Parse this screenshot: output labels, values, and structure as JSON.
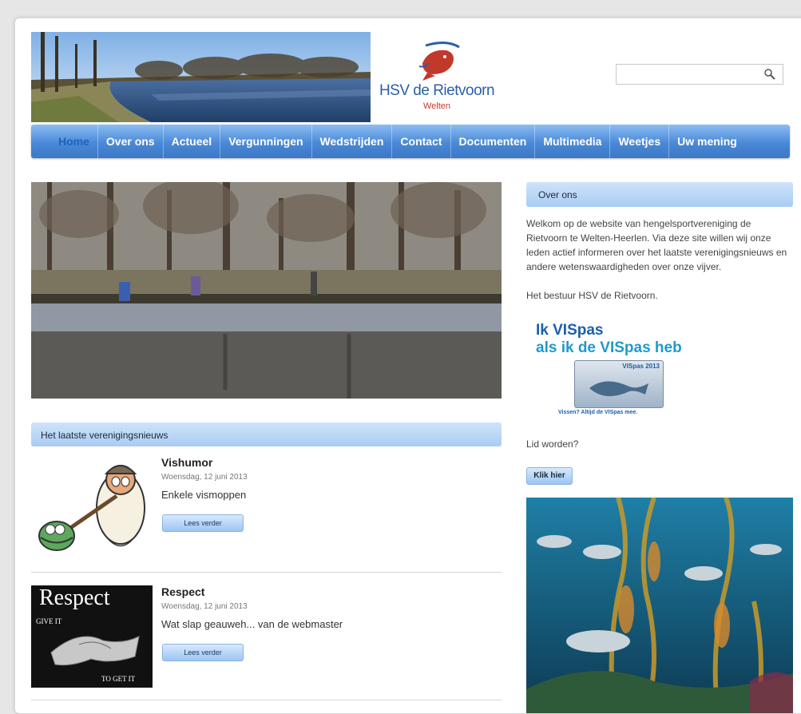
{
  "site": {
    "logo_name": "HSV de Rietvoorn",
    "logo_sub": "Welten"
  },
  "search": {
    "placeholder": "",
    "value": ""
  },
  "nav": {
    "items": [
      "Home",
      "Over ons",
      "Actueel",
      "Vergunningen",
      "Wedstrijden",
      "Contact",
      "Documenten",
      "Multimedia",
      "Weetjes",
      "Uw mening"
    ],
    "active": "Home"
  },
  "news": {
    "section_title": "Het laatste verenigingsnieuws",
    "items": [
      {
        "title": "Vishumor",
        "date": "Woensdag, 12 juni 2013",
        "summary": "Enkele vismoppen",
        "button": "Lees verder"
      },
      {
        "title": "Respect",
        "date": "Woensdag, 12 juni 2013",
        "summary": "Wat slap geauweh... van de webmaster",
        "button": "Lees verder"
      }
    ],
    "respect_image": {
      "headline": "Respect",
      "line1": "GIVE IT",
      "line2": "TO GET IT"
    }
  },
  "sidebar": {
    "about_title": "Over ons",
    "about_text": "Welkom op de website van hengelsportvereniging de Rietvoorn te Welten-Heerlen. Via deze site willen wij onze leden actief informeren over het laatste verenigingsnieuws en andere wetenswaardigheden over onze vijver.",
    "signoff": "Het bestuur HSV de Rietvoorn.",
    "vispas": {
      "line1": "Ik VISpas",
      "line2": "als ik de VISpas heb",
      "card_label": "VISpas 2013",
      "tagline": "Vissen? Altijd de VISpas mee."
    },
    "join_label": "Lid worden?",
    "join_button": "Klik hier"
  },
  "colors": {
    "nav_blue": "#4a89d7",
    "accent_light": "#cfe3fa",
    "active_link": "#1f63c1"
  }
}
